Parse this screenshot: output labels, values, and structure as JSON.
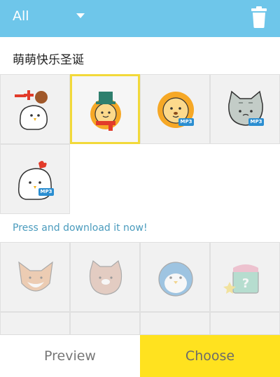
{
  "header": {
    "filter_label": "All",
    "filter_icon": "chevron-down-icon",
    "trash_icon": "trash-icon",
    "bar_color": "#6ec6ea"
  },
  "pack": {
    "title": "萌萌快乐圣诞",
    "stickers": [
      {
        "name": "chicken-plus-minus",
        "badge": ""
      },
      {
        "name": "lion-hat-scarf",
        "badge": "",
        "selected": true
      },
      {
        "name": "lion-face",
        "badge": "MP3"
      },
      {
        "name": "grey-cat",
        "badge": "MP3"
      },
      {
        "name": "chicken",
        "badge": "MP3"
      }
    ]
  },
  "prompt": "Press and download it now!",
  "locked_stickers": [
    {
      "name": "fox"
    },
    {
      "name": "pink-cat"
    },
    {
      "name": "penguin"
    },
    {
      "name": "mystery-gift"
    }
  ],
  "footer": {
    "preview_label": "Preview",
    "choose_label": "Choose",
    "accent": "#ffe21f"
  }
}
